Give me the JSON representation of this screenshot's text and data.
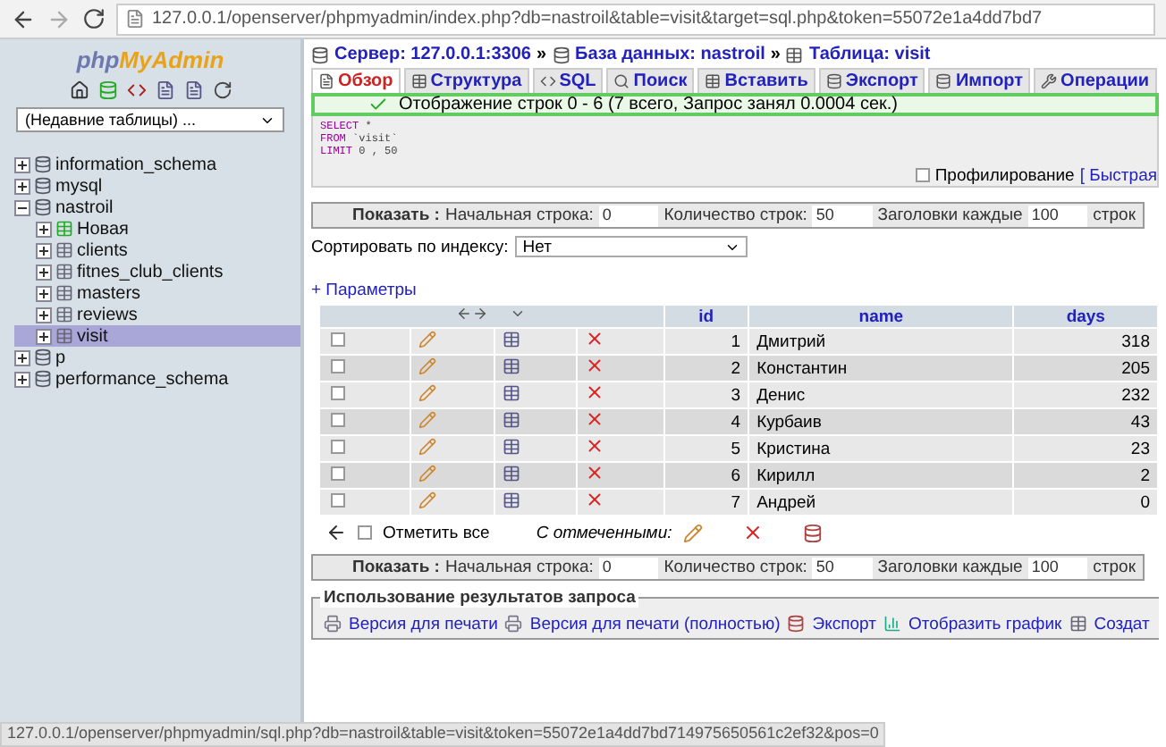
{
  "browser": {
    "url": "127.0.0.1/openserver/phpmyadmin/index.php?db=nastroil&table=visit&target=sql.php&token=55072e1a4dd7bd7"
  },
  "sidebar": {
    "logo": [
      "php",
      "MyAdmin"
    ],
    "recent_tables": "(Недавние таблицы) ...",
    "tree": [
      {
        "label": "information_schema",
        "expanded": false,
        "selected": false
      },
      {
        "label": "mysql",
        "expanded": false,
        "selected": false
      },
      {
        "label": "nastroil",
        "expanded": true,
        "selected": false,
        "children": [
          {
            "label": "Новая",
            "kind": "new",
            "selected": false
          },
          {
            "label": "clients",
            "kind": "table",
            "selected": false
          },
          {
            "label": "fitnes_club_clients",
            "kind": "table",
            "selected": false
          },
          {
            "label": "masters",
            "kind": "table",
            "selected": false
          },
          {
            "label": "reviews",
            "kind": "table",
            "selected": false
          },
          {
            "label": "visit",
            "kind": "table",
            "selected": true
          }
        ]
      },
      {
        "label": "p",
        "expanded": false,
        "selected": false
      },
      {
        "label": "performance_schema",
        "expanded": false,
        "selected": false
      }
    ]
  },
  "breadcrumb": {
    "separator": "»",
    "items": [
      "Сервер: 127.0.0.1:3306",
      "База данных: nastroil",
      "Таблица: visit"
    ]
  },
  "tabs": [
    {
      "label": "Обзор",
      "selected": true
    },
    {
      "label": "Структура",
      "selected": false
    },
    {
      "label": "SQL",
      "selected": false
    },
    {
      "label": "Поиск",
      "selected": false
    },
    {
      "label": "Вставить",
      "selected": false
    },
    {
      "label": "Экспорт",
      "selected": false
    },
    {
      "label": "Импорт",
      "selected": false
    },
    {
      "label": "Операции",
      "selected": false
    }
  ],
  "message": "Отображение строк 0 - 6 (7 всего, Запрос занял 0.0004 сек.)",
  "sql": [
    {
      "keyword": "SELECT",
      "rest": "*"
    },
    {
      "keyword": "FROM",
      "rest": "`visit`"
    },
    {
      "keyword": "LIMIT",
      "rest": "0 , 50"
    }
  ],
  "profiling": {
    "label": "Профилирование",
    "checked": false,
    "link": "[ Быстрая"
  },
  "navigation": [
    {
      "show": "Показать :",
      "start_label": "Начальная строка:",
      "start": "0",
      "count_label": "Количество строк:",
      "count": "50",
      "headers_label": "Заголовки каждые",
      "headers": "100",
      "unit": "строк"
    },
    {
      "show": "Показать :",
      "start_label": "Начальная строка:",
      "start": "0",
      "count_label": "Количество строк:",
      "count": "50",
      "headers_label": "Заголовки каждые",
      "headers": "100",
      "unit": "строк"
    }
  ],
  "sort": {
    "label": "Сортировать по индексу:",
    "value": "Нет"
  },
  "options_link": "+ Параметры",
  "table": {
    "columns": [
      "id",
      "name",
      "days"
    ],
    "rows": [
      {
        "checked": false,
        "cells": [
          "1",
          "Дмитрий",
          "318"
        ]
      },
      {
        "checked": false,
        "cells": [
          "2",
          "Константин",
          "205"
        ]
      },
      {
        "checked": false,
        "cells": [
          "3",
          "Денис",
          "232"
        ]
      },
      {
        "checked": false,
        "cells": [
          "4",
          "Курбаив",
          "43"
        ]
      },
      {
        "checked": false,
        "cells": [
          "5",
          "Кристина",
          "23"
        ]
      },
      {
        "checked": false,
        "cells": [
          "6",
          "Кирилл",
          "2"
        ]
      },
      {
        "checked": false,
        "cells": [
          "7",
          "Андрей",
          "0"
        ]
      }
    ]
  },
  "check_all": {
    "label": "Отметить все",
    "checked": false,
    "with_selected": "С отмеченными:"
  },
  "query_results": {
    "legend": "Использование результатов запроса",
    "links": [
      {
        "label": "Версия для печати",
        "kind": "print"
      },
      {
        "label": "Версия для печати (полностью)",
        "kind": "print"
      },
      {
        "label": "Экспорт",
        "kind": "export"
      },
      {
        "label": "Отобразить график",
        "kind": "chart"
      },
      {
        "label": "Создат",
        "kind": "view"
      }
    ]
  },
  "status_bar": "127.0.0.1/openserver/phpmyadmin/sql.php?db=nastroil&table=visit&token=55072e1a4dd7bd714975650561c2ef32&pos=0"
}
